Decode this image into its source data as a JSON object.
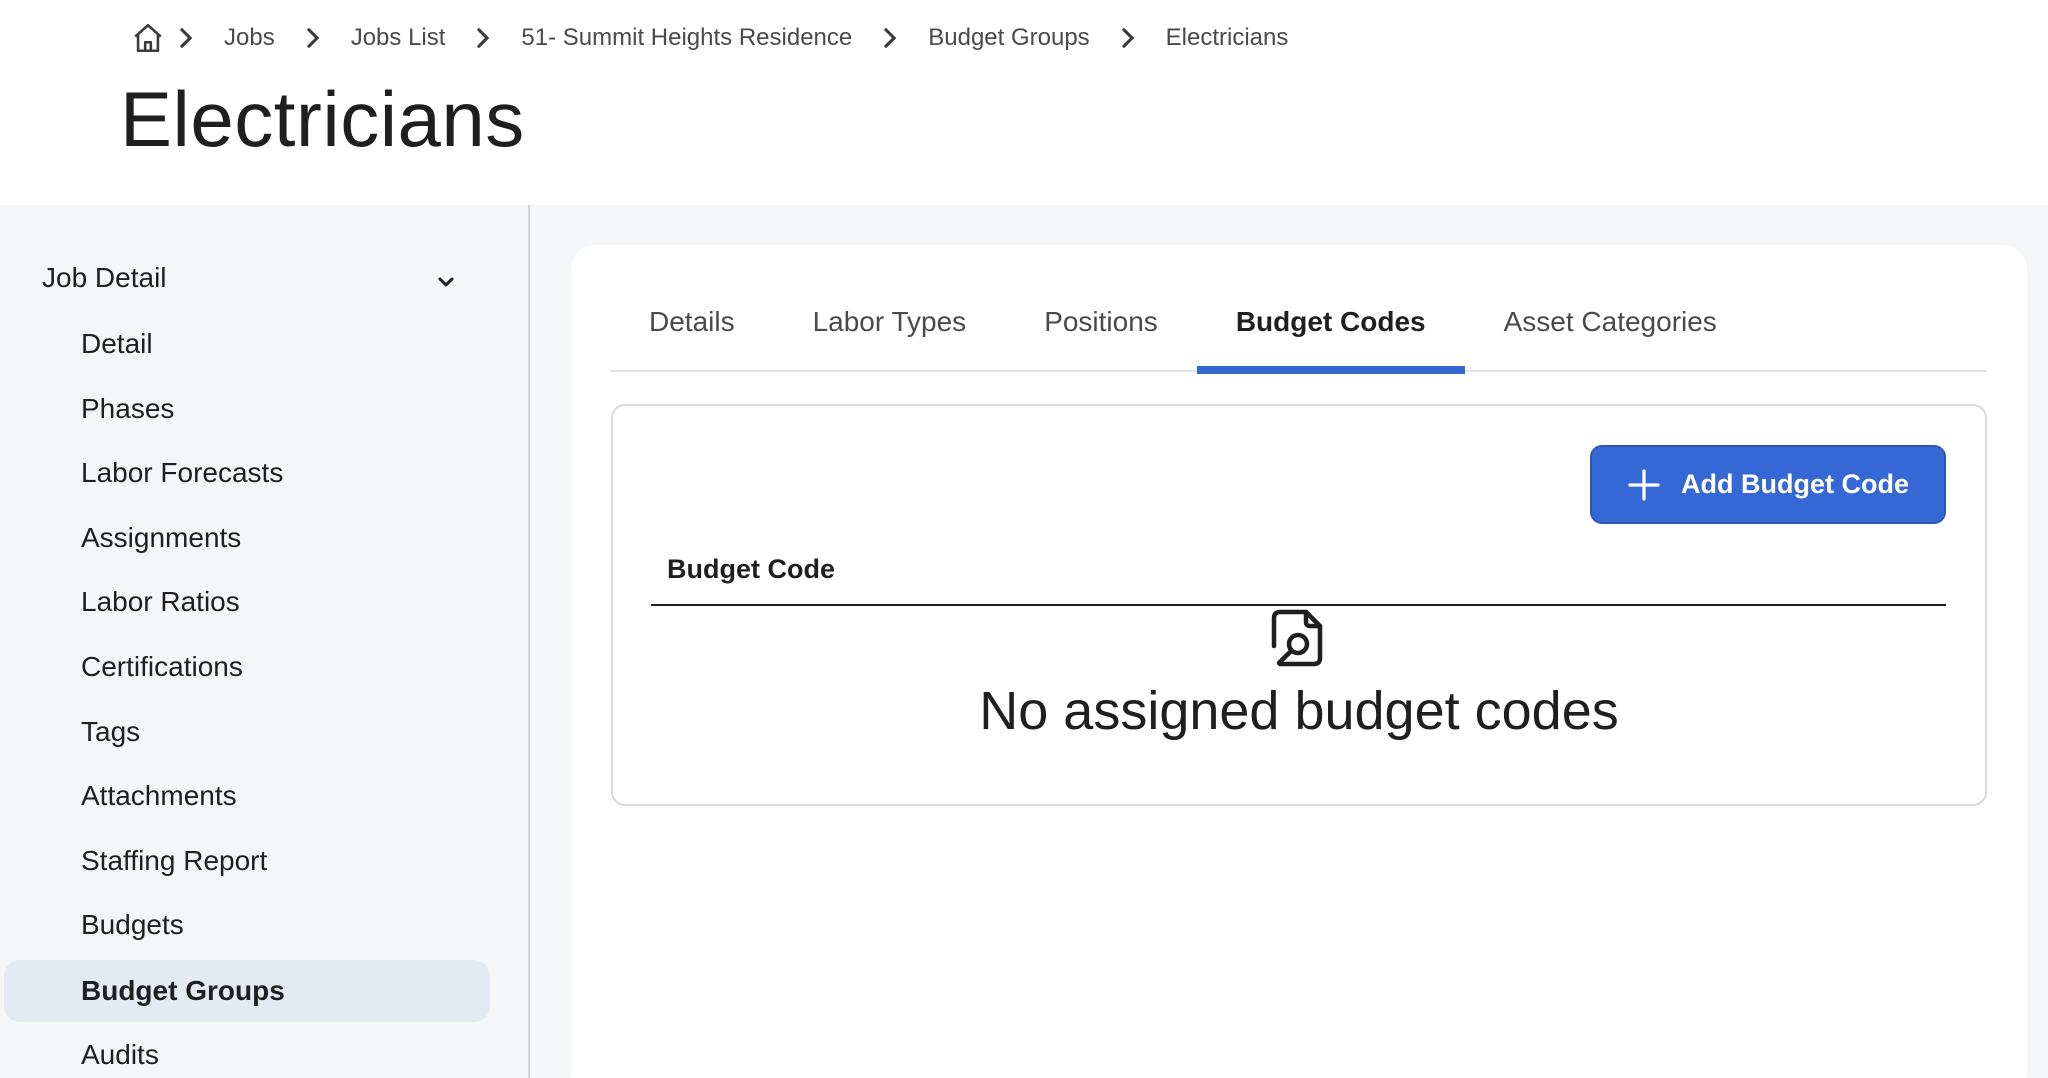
{
  "breadcrumb": {
    "home_icon": "home-icon",
    "items": [
      "Jobs",
      "Jobs List",
      "51- Summit Heights Residence",
      "Budget Groups"
    ],
    "current": "Electricians"
  },
  "page": {
    "title": "Electricians"
  },
  "sidebar": {
    "group_label": "Job Detail",
    "items": [
      {
        "label": "Detail"
      },
      {
        "label": "Phases"
      },
      {
        "label": "Labor Forecasts"
      },
      {
        "label": "Assignments"
      },
      {
        "label": "Labor Ratios"
      },
      {
        "label": "Certifications"
      },
      {
        "label": "Tags"
      },
      {
        "label": "Attachments"
      },
      {
        "label": "Staffing Report"
      },
      {
        "label": "Budgets"
      },
      {
        "label": "Budget Groups",
        "active": true
      },
      {
        "label": "Audits"
      }
    ]
  },
  "tabs": [
    {
      "label": "Details"
    },
    {
      "label": "Labor Types"
    },
    {
      "label": "Positions"
    },
    {
      "label": "Budget Codes",
      "active": true
    },
    {
      "label": "Asset Categories"
    }
  ],
  "budget_codes": {
    "add_button_label": "Add Budget Code",
    "column_header": "Budget Code",
    "empty_message": "No assigned budget codes"
  },
  "colors": {
    "accent": "#3568d4",
    "active_sidebar_bg": "#e3eaf4",
    "page_bg": "#f5f6f8"
  }
}
